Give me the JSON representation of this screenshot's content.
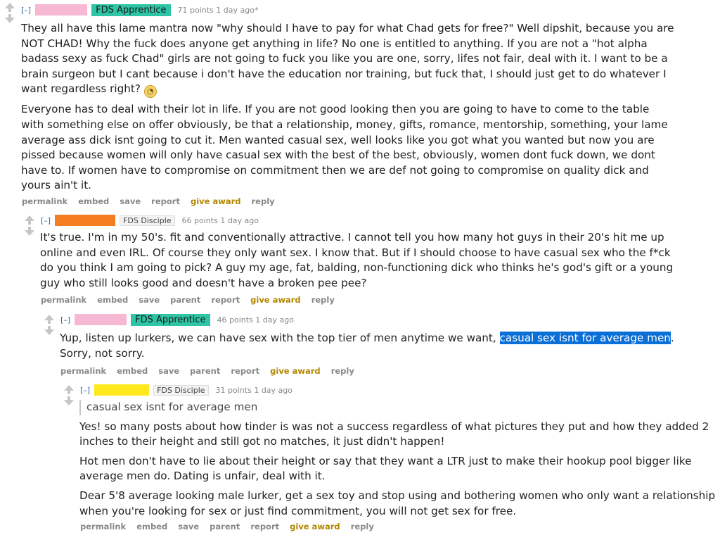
{
  "colors": {
    "flair_apprentice": "#2ec4a6",
    "highlight": "#0a6fd6",
    "award": "#b38600",
    "username_c1": "#f6b8d2",
    "username_c2": "#f57c20",
    "username_c3": "#f6b8d2",
    "username_c4": "#ffe81c"
  },
  "comments": [
    {
      "expand": "[–]",
      "flair": "FDS Apprentice",
      "score": "71 points 1 day ago*",
      "paragraphs": [
        "They all have this lame mantra now \"why should I have to pay for what Chad gets for free?\" Well dipshit, because you are NOT CHAD! Why the fuck does anyone get anything in life? No one is entitled to anything. If you are not a \"hot alpha badass sexy as fuck Chad\" girls are not going to fuck you like you are one, sorry, lifes not fair, deal with it. I want to be a brain surgeon but I cant because i don't have the education nor training, but fuck that, I should just get to do whatever I want regardless right?",
        "Everyone has to deal with their lot in life. If you are not good looking then you are going to have to come to the table with something else on offer obviously, be that a relationship, money, gifts, romance, mentorship, something, your lame average ass dick isnt going to cut it. Men wanted casual sex, well looks like you got what you wanted but now you are pissed because women will only have casual sex with the best of the best, obviously, women dont fuck down, we dont have to. If women have to compromise on commitment then we are def not going to compromise on quality dick and yours ain't it."
      ],
      "emoji_icon": "rolling-eyes-emoji-icon",
      "actions": [
        "permalink",
        "embed",
        "save",
        "report",
        "give award",
        "reply"
      ]
    },
    {
      "expand": "[–]",
      "flair": "FDS Disciple",
      "score": "66 points 1 day ago",
      "paragraphs": [
        "It's true. I'm in my 50's. fit and conventionally attractive. I cannot tell you how many hot guys in their 20's hit me up online and even IRL. Of course they only want sex. I know that. But if I should choose to have casual sex who the f*ck do you think I am going to pick? A guy my age, fat, balding, non-functioning dick who thinks he's god's gift or a young guy who still looks good and doesn't have a broken pee pee?"
      ],
      "actions": [
        "permalink",
        "embed",
        "save",
        "parent",
        "report",
        "give award",
        "reply"
      ]
    },
    {
      "expand": "[–]",
      "flair": "FDS Apprentice",
      "score": "46 points 1 day ago",
      "text_before": "Yup, listen up lurkers, we can have sex with the top tier of men anytime we want,",
      "text_highlight": "casual sex isnt for average men",
      "text_after": ".",
      "text_line2": "Sorry, not sorry.",
      "actions": [
        "permalink",
        "embed",
        "save",
        "parent",
        "report",
        "give award",
        "reply"
      ]
    },
    {
      "expand": "[–]",
      "flair": "FDS Disciple",
      "score": "31 points 1 day ago",
      "quote": "casual sex isnt for average men",
      "paragraphs": [
        "Yes! so many posts about how tinder is was not a success regardless of what pictures they put and how they added 2 inches to their height and still got no matches, it just didn't happen!",
        "Hot men don't have to lie about their height or say that they want a LTR just to make their hookup pool bigger like average men do. Dating is unfair, deal with it.",
        "Dear 5'8 average looking male lurker, get a sex toy and stop using and bothering women who only want a relationship when you're looking for sex or just find commitment, you will not get sex for free."
      ],
      "actions": [
        "permalink",
        "embed",
        "save",
        "parent",
        "report",
        "give award",
        "reply"
      ]
    }
  ]
}
